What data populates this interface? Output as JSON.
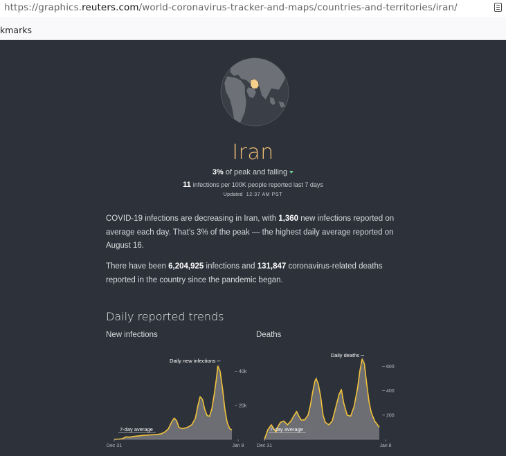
{
  "browser": {
    "url_prefix": "https://graphics.",
    "url_domain": "reuters.com",
    "url_path": "/world-coronavirus-tracker-and-maps/countries-and-territories/iran/",
    "bookmarks_label": "kmarks",
    "reader_icon": "reader-view-icon"
  },
  "header": {
    "country": "Iran",
    "peak_pct": "3%",
    "peak_text": "of peak and falling",
    "trend_icon": "down-triangle-icon",
    "per100k_value": "11",
    "per100k_text": "infections per 100K people reported last 7 days",
    "updated_label": "Updated",
    "updated_time": "12:37 AM PST"
  },
  "summary": {
    "p1_a": "COVID-19 infections are decreasing in Iran, with ",
    "p1_num": "1,360",
    "p1_b": " new infections reported on average each day. That’s 3% of the peak — the highest daily average reported on August 16.",
    "p2_a": "There have been ",
    "p2_inf": "6,204,925",
    "p2_b": " infections and ",
    "p2_deaths": "131,847",
    "p2_c": " coronavirus-related deaths reported in the country since the pandemic began."
  },
  "trends": {
    "heading": "Daily reported trends",
    "infections_label": "New infections",
    "deaths_label": "Deaths"
  },
  "chart_data": [
    {
      "type": "area",
      "name": "infections",
      "daily_label": "Daily new infections",
      "avg_label": "7-day average",
      "x_start_label": "Dec 31",
      "x_end_label": "Jan 8",
      "yticks": [
        20000,
        40000
      ],
      "ytick_labels": [
        "20k",
        "40k"
      ],
      "ylim": [
        0,
        50000
      ],
      "avg_points": [
        [
          0,
          100
        ],
        [
          0.04,
          150
        ],
        [
          0.07,
          400
        ],
        [
          0.1,
          1500
        ],
        [
          0.13,
          1300
        ],
        [
          0.16,
          1700
        ],
        [
          0.2,
          2000
        ],
        [
          0.25,
          2400
        ],
        [
          0.3,
          2600
        ],
        [
          0.36,
          2900
        ],
        [
          0.4,
          3300
        ],
        [
          0.43,
          4300
        ],
        [
          0.46,
          6200
        ],
        [
          0.49,
          10500
        ],
        [
          0.51,
          12500
        ],
        [
          0.53,
          11000
        ],
        [
          0.55,
          7000
        ],
        [
          0.58,
          6300
        ],
        [
          0.62,
          7000
        ],
        [
          0.66,
          8600
        ],
        [
          0.69,
          12500
        ],
        [
          0.71,
          19500
        ],
        [
          0.73,
          25000
        ],
        [
          0.75,
          23500
        ],
        [
          0.77,
          17500
        ],
        [
          0.79,
          14000
        ],
        [
          0.81,
          13500
        ],
        [
          0.83,
          18000
        ],
        [
          0.85,
          26500
        ],
        [
          0.87,
          36500
        ],
        [
          0.88,
          43000
        ],
        [
          0.9,
          40000
        ],
        [
          0.92,
          30000
        ],
        [
          0.94,
          18000
        ],
        [
          0.96,
          10000
        ],
        [
          0.98,
          6500
        ],
        [
          1,
          5500
        ]
      ],
      "daily_peak": 46000,
      "avg_end_marker": 1360
    },
    {
      "type": "area",
      "name": "deaths",
      "daily_label": "Daily deaths",
      "avg_label": "7-day average",
      "x_start_label": "Dec 31",
      "x_end_label": "Jan 8",
      "yticks": [
        200,
        400,
        600
      ],
      "ytick_labels": [
        "200",
        "400",
        "600"
      ],
      "ylim": [
        0,
        700
      ],
      "avg_points": [
        [
          0,
          0
        ],
        [
          0.03,
          80
        ],
        [
          0.06,
          120
        ],
        [
          0.08,
          90
        ],
        [
          0.1,
          60
        ],
        [
          0.12,
          110
        ],
        [
          0.14,
          140
        ],
        [
          0.17,
          150
        ],
        [
          0.2,
          120
        ],
        [
          0.23,
          150
        ],
        [
          0.26,
          200
        ],
        [
          0.28,
          230
        ],
        [
          0.3,
          190
        ],
        [
          0.32,
          160
        ],
        [
          0.35,
          160
        ],
        [
          0.38,
          200
        ],
        [
          0.4,
          280
        ],
        [
          0.42,
          390
        ],
        [
          0.44,
          480
        ],
        [
          0.45,
          500
        ],
        [
          0.47,
          450
        ],
        [
          0.49,
          350
        ],
        [
          0.51,
          200
        ],
        [
          0.53,
          140
        ],
        [
          0.56,
          120
        ],
        [
          0.59,
          150
        ],
        [
          0.62,
          260
        ],
        [
          0.65,
          370
        ],
        [
          0.67,
          410
        ],
        [
          0.69,
          300
        ],
        [
          0.72,
          200
        ],
        [
          0.75,
          190
        ],
        [
          0.78,
          270
        ],
        [
          0.81,
          420
        ],
        [
          0.83,
          560
        ],
        [
          0.85,
          660
        ],
        [
          0.87,
          620
        ],
        [
          0.89,
          460
        ],
        [
          0.91,
          310
        ],
        [
          0.93,
          220
        ],
        [
          0.96,
          150
        ],
        [
          1,
          100
        ]
      ],
      "daily_peak": 690,
      "avg_end_marker": 30
    }
  ]
}
